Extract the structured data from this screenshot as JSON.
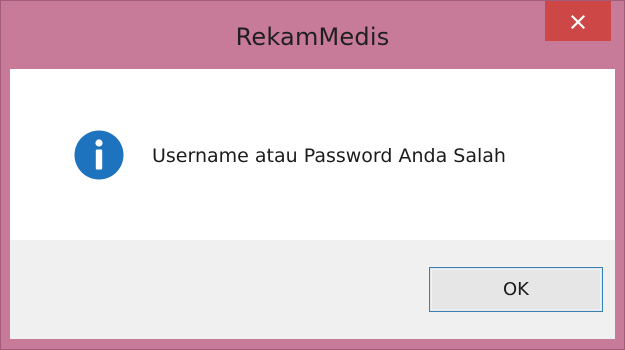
{
  "window": {
    "title": "RekamMedis"
  },
  "dialog": {
    "icon": "info-icon",
    "message": "Username atau Password Anda Salah",
    "ok_label": "OK"
  },
  "colors": {
    "frame": "#c87a99",
    "close_button": "#cd4747",
    "info_icon": "#1e73be",
    "button_border": "#3c7fb1"
  }
}
